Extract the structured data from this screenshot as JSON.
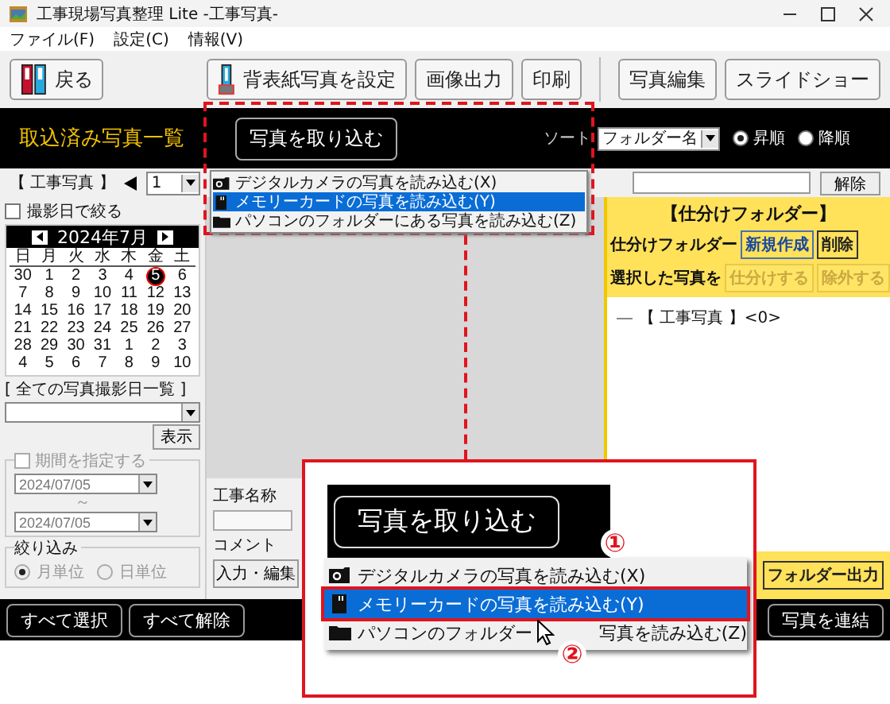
{
  "window": {
    "title": "工事現場写真整理 Lite -工事写真-"
  },
  "menu_bar": [
    "ファイル(F)",
    "設定(C)",
    "情報(V)"
  ],
  "toolbar": [
    "戻る",
    "背表紙写真を設定",
    "画像出力",
    "印刷",
    "写真編集",
    "スライドショー"
  ],
  "header": {
    "title": "取込済み写真一覧",
    "import_button": "写真を取り込む",
    "sort_label": "ソート",
    "sort_value": "フォルダー名",
    "order": [
      {
        "label": "昇順",
        "selected": true
      },
      {
        "label": "降順",
        "selected": false
      }
    ]
  },
  "folder_bar": {
    "title": "【 工事写真 】",
    "page_value": "1",
    "clear_button": "解除"
  },
  "date_filter": {
    "checkbox": {
      "label": "撮影日で絞る",
      "checked": false
    },
    "calendar": {
      "month": "2024年7月",
      "weekdays": [
        "日",
        "月",
        "火",
        "水",
        "木",
        "金",
        "土"
      ],
      "weeks": [
        [
          {
            "d": "30",
            "selected": false
          },
          {
            "d": "1",
            "selected": false
          },
          {
            "d": "2",
            "selected": false
          },
          {
            "d": "3",
            "selected": false
          },
          {
            "d": "4",
            "selected": false
          },
          {
            "d": "5",
            "selected": true
          },
          {
            "d": "6",
            "selected": false
          }
        ],
        [
          {
            "d": "7",
            "selected": false
          },
          {
            "d": "8",
            "selected": false
          },
          {
            "d": "9",
            "selected": false
          },
          {
            "d": "10",
            "selected": false
          },
          {
            "d": "11",
            "selected": false
          },
          {
            "d": "12",
            "selected": false
          },
          {
            "d": "13",
            "selected": false
          }
        ],
        [
          {
            "d": "14",
            "selected": false
          },
          {
            "d": "15",
            "selected": false
          },
          {
            "d": "16",
            "selected": false
          },
          {
            "d": "17",
            "selected": false
          },
          {
            "d": "18",
            "selected": false
          },
          {
            "d": "19",
            "selected": false
          },
          {
            "d": "20",
            "selected": false
          }
        ],
        [
          {
            "d": "21",
            "selected": false
          },
          {
            "d": "22",
            "selected": false
          },
          {
            "d": "23",
            "selected": false
          },
          {
            "d": "24",
            "selected": false
          },
          {
            "d": "25",
            "selected": false
          },
          {
            "d": "26",
            "selected": false
          },
          {
            "d": "27",
            "selected": false
          }
        ],
        [
          {
            "d": "28",
            "selected": false
          },
          {
            "d": "29",
            "selected": false
          },
          {
            "d": "30",
            "selected": false
          },
          {
            "d": "31",
            "selected": false
          },
          {
            "d": "1",
            "selected": false
          },
          {
            "d": "2",
            "selected": false
          },
          {
            "d": "3",
            "selected": false
          }
        ],
        [
          {
            "d": "4",
            "selected": false
          },
          {
            "d": "5",
            "selected": false
          },
          {
            "d": "6",
            "selected": false
          },
          {
            "d": "7",
            "selected": false
          },
          {
            "d": "8",
            "selected": false
          },
          {
            "d": "9",
            "selected": false
          },
          {
            "d": "10",
            "selected": false
          }
        ]
      ]
    },
    "list_label": "[ 全ての写真撮影日一覧 ]",
    "show_button": "表示",
    "period": {
      "label": "期間を指定する",
      "checked": false,
      "disabled": true,
      "from": "2024/07/05",
      "separator": "～",
      "to": "2024/07/05"
    },
    "narrow": {
      "label": "絞り込み",
      "disabled": true,
      "options": [
        {
          "label": "月単位",
          "selected": true
        },
        {
          "label": "日単位",
          "selected": false
        }
      ]
    }
  },
  "details": {
    "name_label": "工事名称",
    "comment_label": "コメント",
    "edit_button": "入力・編集"
  },
  "sort_folders": {
    "title": "【仕分けフォルダー】",
    "folder_label": "仕分けフォルダー",
    "folder_buttons": [
      {
        "label": "新規作成",
        "disabled": false
      },
      {
        "label": "削除",
        "disabled": false
      }
    ],
    "selected_label": "選択した写真を",
    "selected_buttons": [
      {
        "label": "仕分けする",
        "disabled": true
      },
      {
        "label": "除外する",
        "disabled": true
      }
    ],
    "tree": [
      {
        "label": "【 工事写真 】",
        "count": "<0>"
      }
    ],
    "export_button": "フォルダー出力"
  },
  "bottom_bar": [
    "すべて選択",
    "すべて解除",
    "写真を連結"
  ],
  "import_menu": {
    "items": [
      {
        "label": "デジタルカメラの写真を読み込む(X)",
        "selected": false
      },
      {
        "label": "メモリーカードの写真を読み込む(Y)",
        "selected": true
      },
      {
        "label": "パソコンのフォルダーにある写真を読み込む(Z)",
        "selected": false
      }
    ]
  },
  "callout": {
    "button": "写真を取り込む",
    "step_1": "①",
    "step_2": "②",
    "items": [
      {
        "label": "デジタルカメラの写真を読み込む(X)",
        "selected": false
      },
      {
        "label": "メモリーカードの写真を読み込む(Y)",
        "selected": true
      },
      {
        "label": "パソコンのフォルダー",
        "label_after": "写真を読み込む(Z)",
        "selected": false
      }
    ]
  }
}
